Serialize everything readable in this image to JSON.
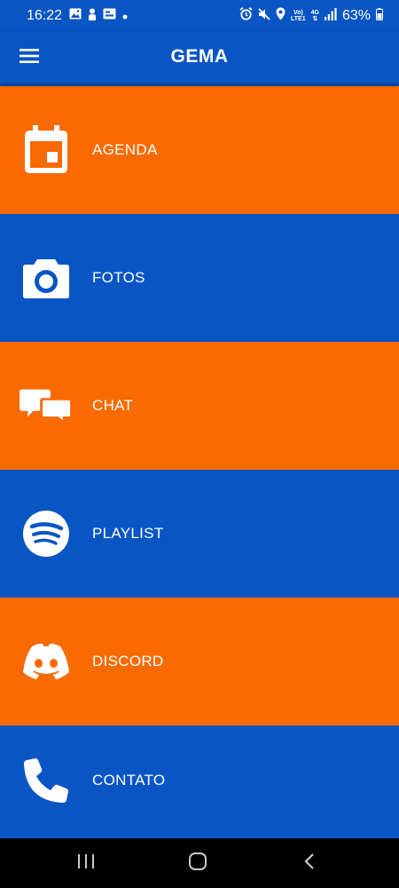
{
  "status_bar": {
    "time": "16:22",
    "network_top": "Vo)",
    "network_bottom": "LTE1",
    "network_type": "4G",
    "battery": "63%"
  },
  "app_bar": {
    "title": "GEMA"
  },
  "menu": {
    "items": [
      {
        "label": "AGENDA",
        "icon": "calendar-icon",
        "color": "#f96a02"
      },
      {
        "label": "FOTOS",
        "icon": "camera-icon",
        "color": "#0a55c4"
      },
      {
        "label": "CHAT",
        "icon": "chat-bubbles-icon",
        "color": "#f96a02"
      },
      {
        "label": "PLAYLIST",
        "icon": "spotify-icon",
        "color": "#0a55c4"
      },
      {
        "label": "DISCORD",
        "icon": "discord-icon",
        "color": "#f96a02"
      },
      {
        "label": "CONTATO",
        "icon": "phone-icon",
        "color": "#0a55c4"
      }
    ]
  },
  "colors": {
    "primary_blue": "#0a55c4",
    "accent_orange": "#f96a02",
    "nav_bar": "#000000"
  }
}
